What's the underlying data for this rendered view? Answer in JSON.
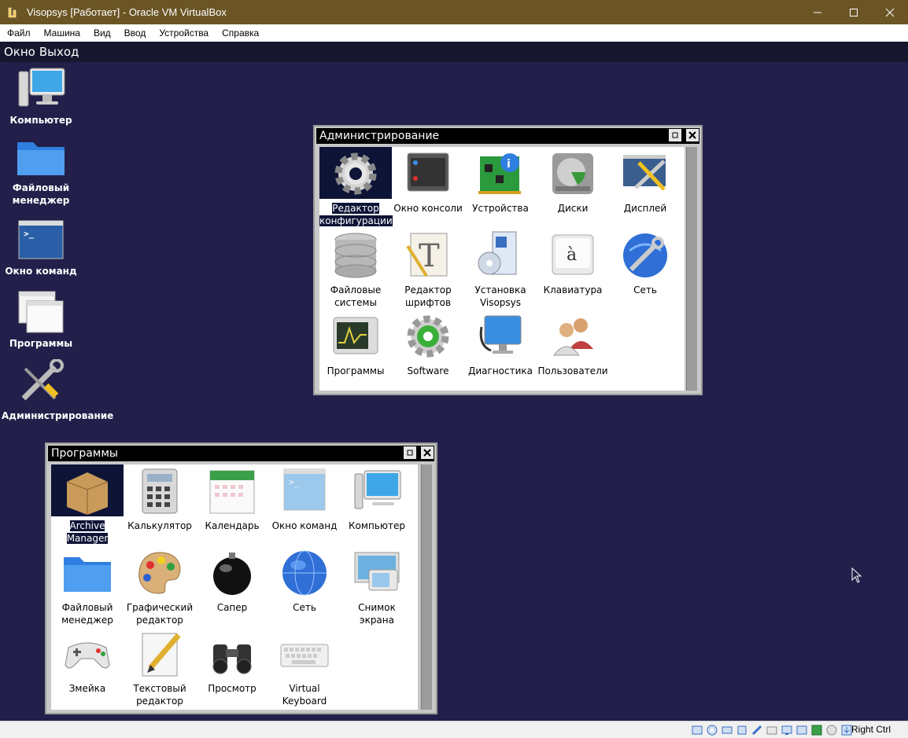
{
  "host": {
    "title": "Visopsys [Работает] - Oracle VM VirtualBox",
    "menu": [
      "Файл",
      "Машина",
      "Вид",
      "Ввод",
      "Устройства",
      "Справка"
    ],
    "host_key": "Right Ctrl"
  },
  "guest": {
    "topbar": [
      "Окно",
      "Выход"
    ],
    "desktop_icons": [
      {
        "label": "Компьютер",
        "icon": "computer-icon"
      },
      {
        "label": "Файловый менеджер",
        "icon": "folder-icon"
      },
      {
        "label": "Окно команд",
        "icon": "terminal-icon"
      },
      {
        "label": "Программы",
        "icon": "windows-icon"
      },
      {
        "label": "Администрирование",
        "icon": "tools-icon"
      }
    ],
    "admin_window": {
      "title": "Администрирование",
      "items": [
        {
          "label": "Редактор конфигурации",
          "icon": "gear-icon",
          "selected": true
        },
        {
          "label": "Окно консоли",
          "icon": "console-icon"
        },
        {
          "label": "Устройства",
          "icon": "devices-icon"
        },
        {
          "label": "Диски",
          "icon": "disk-icon"
        },
        {
          "label": "Дисплей",
          "icon": "display-icon"
        },
        {
          "label": "Файловые системы",
          "icon": "database-icon"
        },
        {
          "label": "Редактор шрифтов",
          "icon": "font-icon"
        },
        {
          "label": "Установка Visopsys",
          "icon": "install-icon"
        },
        {
          "label": "Клавиатура",
          "icon": "keyboard-key-icon"
        },
        {
          "label": "Сеть",
          "icon": "network-icon"
        },
        {
          "label": "Программы",
          "icon": "monitor-program-icon"
        },
        {
          "label": "Software",
          "icon": "software-icon"
        },
        {
          "label": "Диагностика",
          "icon": "diagnostics-icon"
        },
        {
          "label": "Пользователи",
          "icon": "users-icon"
        }
      ]
    },
    "programs_window": {
      "title": "Программы",
      "items": [
        {
          "label": "Archive Manager",
          "icon": "archive-icon",
          "selected": true
        },
        {
          "label": "Калькулятор",
          "icon": "calculator-icon"
        },
        {
          "label": "Календарь",
          "icon": "calendar-icon"
        },
        {
          "label": "Окно команд",
          "icon": "terminal-icon"
        },
        {
          "label": "Компьютер",
          "icon": "computer-icon"
        },
        {
          "label": "Файловый менеджер",
          "icon": "folder-icon"
        },
        {
          "label": "Графический редактор",
          "icon": "paint-icon"
        },
        {
          "label": "Сапер",
          "icon": "bomb-icon"
        },
        {
          "label": "Сеть",
          "icon": "globe-icon"
        },
        {
          "label": "Снимок экрана",
          "icon": "screenshot-icon"
        },
        {
          "label": "Змейка",
          "icon": "gamepad-icon"
        },
        {
          "label": "Текстовый редактор",
          "icon": "pencil-icon"
        },
        {
          "label": "Просмотр",
          "icon": "binoculars-icon"
        },
        {
          "label": "Virtual Keyboard",
          "icon": "keyboard-icon"
        }
      ]
    }
  },
  "colors": {
    "host_titlebar": "#6b5525",
    "guest_bg": "#22204a",
    "selection": "#0e1436"
  }
}
